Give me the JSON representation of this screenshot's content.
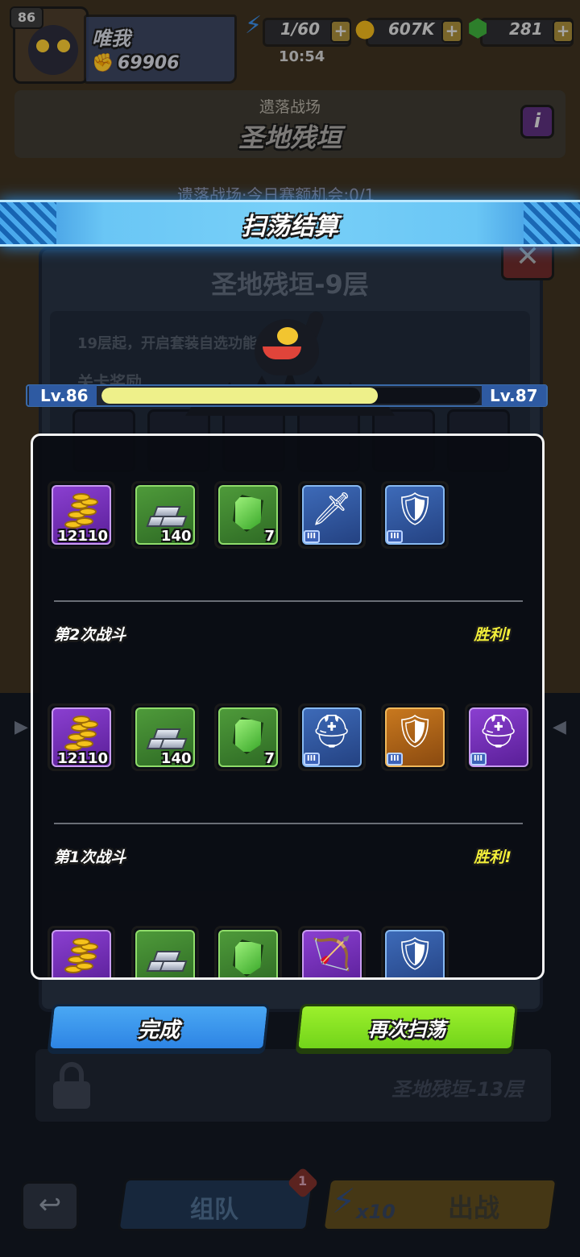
{
  "player": {
    "level": "86",
    "name": "唯我",
    "power": "69906"
  },
  "resources": {
    "energy": "1/60",
    "coins": "607K",
    "gems": "281",
    "clock": "10:54"
  },
  "stage": {
    "category": "遗落战场",
    "name": "圣地残垣",
    "info_button": "i",
    "behind_text": "遗落战场·今日赛额机会:0/1"
  },
  "under_panel": {
    "title": "圣地残垣-9层",
    "hint": "19层起，开启套装自选功能",
    "section": "关卡奖励",
    "locked_floor": "圣地残垣-13层"
  },
  "bottom_bar": {
    "team_label": "组队",
    "team_badge": "1",
    "energy_cost": "x10",
    "battle_label": "出战"
  },
  "modal": {
    "title": "扫荡结算",
    "level_from": "Lv.86",
    "level_to": "Lv.87",
    "xp_progress": 0.73,
    "battles": [
      {
        "items": [
          {
            "type": "coins",
            "rarity": "purple",
            "qty": "12110"
          },
          {
            "type": "ingot",
            "rarity": "green",
            "qty": "140"
          },
          {
            "type": "gem",
            "rarity": "green",
            "qty": "7"
          },
          {
            "type": "sword",
            "rarity": "blue",
            "tier": "III"
          },
          {
            "type": "armor",
            "rarity": "blue",
            "tier": "III"
          }
        ]
      },
      {
        "title": "第2次战斗",
        "result": "胜利!",
        "items": [
          {
            "type": "coins",
            "rarity": "purple",
            "qty": "12110"
          },
          {
            "type": "ingot",
            "rarity": "green",
            "qty": "140"
          },
          {
            "type": "gem",
            "rarity": "green",
            "qty": "7"
          },
          {
            "type": "helmet",
            "rarity": "blue",
            "tier": "III"
          },
          {
            "type": "armor",
            "rarity": "orange",
            "tier": "III"
          },
          {
            "type": "helmet",
            "rarity": "purple",
            "tier": "III"
          }
        ]
      },
      {
        "title": "第1次战斗",
        "result": "胜利!",
        "items": [
          {
            "type": "coins",
            "rarity": "purple"
          },
          {
            "type": "ingot",
            "rarity": "green"
          },
          {
            "type": "gem",
            "rarity": "green"
          },
          {
            "type": "crossbow",
            "rarity": "purple"
          },
          {
            "type": "armor",
            "rarity": "blue"
          }
        ]
      }
    ],
    "done_label": "完成",
    "again_label": "再次扫荡"
  },
  "colors": {
    "victory": "#f2ee3a",
    "done_button": "#2d84e4",
    "again_button": "#72d41a",
    "xp_fill": "#eef08a"
  }
}
